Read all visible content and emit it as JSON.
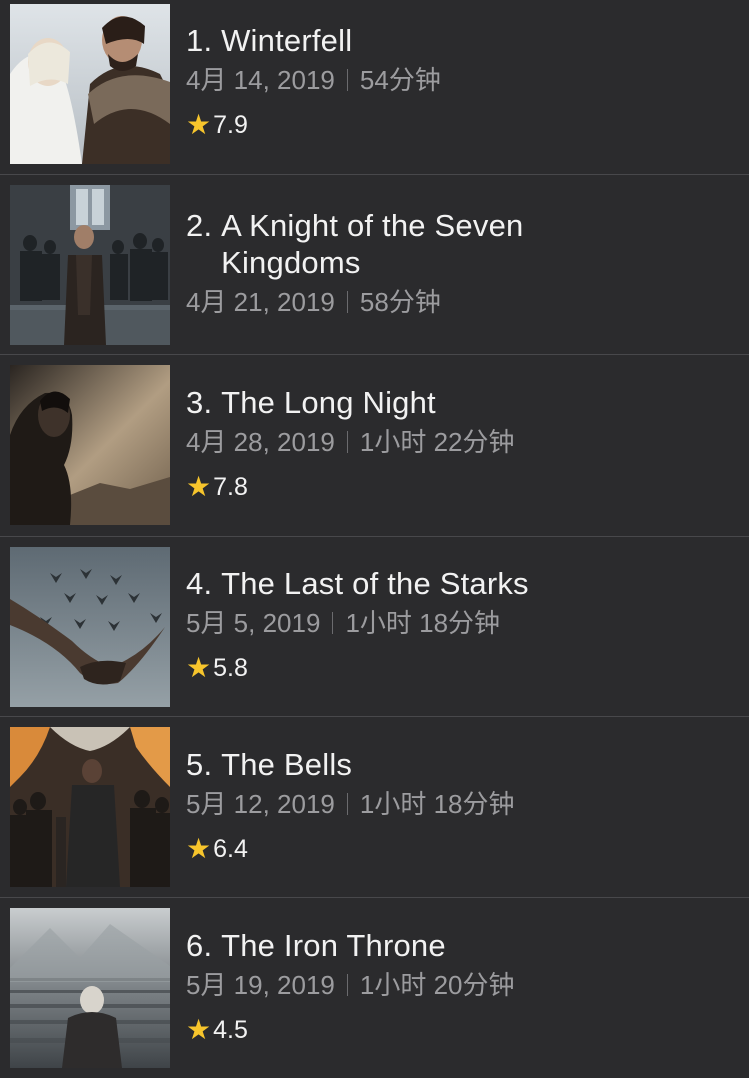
{
  "episodes": [
    {
      "num": "1.",
      "title": "Winterfell",
      "date": "4月 14, 2019",
      "duration": "54分钟",
      "rating": "7.9",
      "star_icon": "★",
      "thumb": "winterfell"
    },
    {
      "num": "2.",
      "title": "A Knight of the Seven Kingdoms",
      "date": "4月 21, 2019",
      "duration": "58分钟",
      "rating": "",
      "star_icon": "★",
      "thumb": "knight"
    },
    {
      "num": "3.",
      "title": "The Long Night",
      "date": "4月 28, 2019",
      "duration": "1小时 22分钟",
      "rating": "7.8",
      "star_icon": "★",
      "thumb": "long-night"
    },
    {
      "num": "4.",
      "title": "The Last of the Starks",
      "date": "5月 5, 2019",
      "duration": "1小时 18分钟",
      "rating": "5.8",
      "star_icon": "★",
      "thumb": "starks"
    },
    {
      "num": "5.",
      "title": "The Bells",
      "date": "5月 12, 2019",
      "duration": "1小时 18分钟",
      "rating": "6.4",
      "star_icon": "★",
      "thumb": "bells"
    },
    {
      "num": "6.",
      "title": "The Iron Throne",
      "date": "5月 19, 2019",
      "duration": "1小时 20分钟",
      "rating": "4.5",
      "star_icon": "★",
      "thumb": "iron-throne"
    }
  ],
  "colors": {
    "background": "#2b2b2d",
    "divider": "#48484b",
    "star": "#f7c52c",
    "title": "#f2f2f2",
    "meta": "#9c9c9f"
  }
}
